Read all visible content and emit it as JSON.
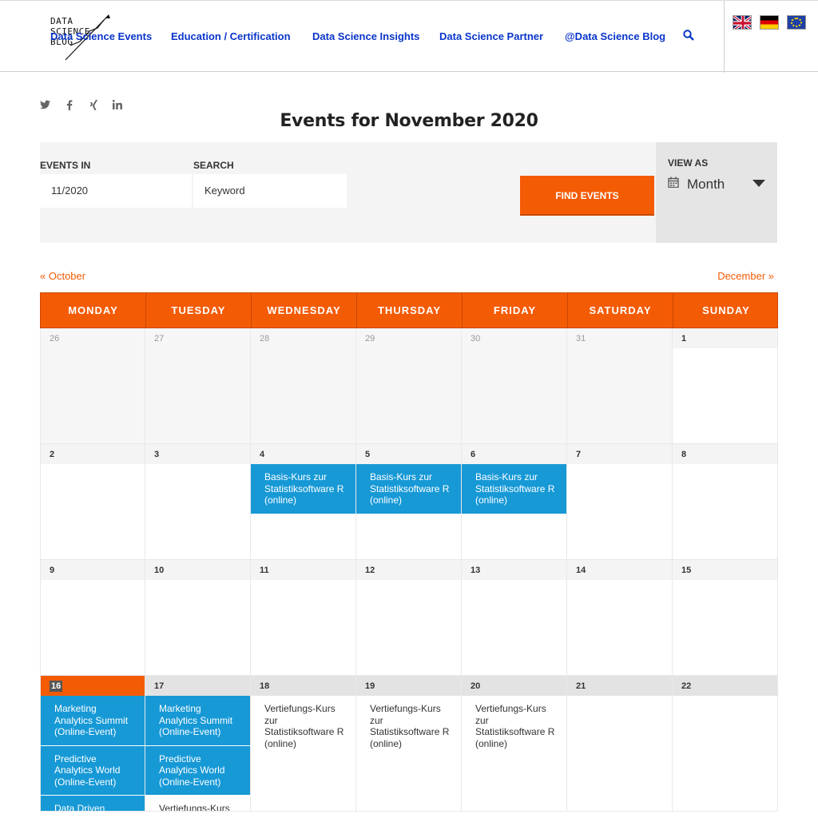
{
  "header": {
    "logo_text": [
      "DATA",
      "SCIENCE",
      "BLOG"
    ],
    "nav": [
      "Data Science Events",
      "Education / Certification",
      "Data Science Insights",
      "Data Science Partner",
      "@Data Science Blog"
    ],
    "flags": [
      "uk-flag",
      "germany-flag",
      "eu-flag"
    ]
  },
  "social": [
    "twitter-icon",
    "facebook-icon",
    "xing-icon",
    "linkedin-icon"
  ],
  "page_title": "Events for November 2020",
  "filter": {
    "events_in_label": "EVENTS IN",
    "events_in_value": "11/2020",
    "search_label": "SEARCH",
    "search_placeholder": "Keyword",
    "find_button": "FIND EVENTS",
    "view_as_label": "VIEW AS",
    "view_as_value": "Month"
  },
  "month_nav": {
    "prev": "« October",
    "next": "December »"
  },
  "colors": {
    "accent": "#f45b05",
    "event_blue": "#1799d6",
    "nav_link": "#0a35c9"
  },
  "calendar": {
    "days": [
      "MONDAY",
      "TUESDAY",
      "WEDNESDAY",
      "THURSDAY",
      "FRIDAY",
      "SATURDAY",
      "SUNDAY"
    ],
    "weeks": [
      [
        {
          "n": "26",
          "past": true
        },
        {
          "n": "27",
          "past": true
        },
        {
          "n": "28",
          "past": true
        },
        {
          "n": "29",
          "past": true
        },
        {
          "n": "30",
          "past": true
        },
        {
          "n": "31",
          "past": true
        },
        {
          "n": "1"
        }
      ],
      [
        {
          "n": "2"
        },
        {
          "n": "3"
        },
        {
          "n": "4",
          "events": [
            {
              "t": "Basis-Kurs zur Statistiksoftware R (online)",
              "blue": true
            }
          ]
        },
        {
          "n": "5",
          "events": [
            {
              "t": "Basis-Kurs zur Statistiksoftware R (online)",
              "blue": true
            }
          ]
        },
        {
          "n": "6",
          "events": [
            {
              "t": "Basis-Kurs zur Statistiksoftware R (online)",
              "blue": true
            }
          ]
        },
        {
          "n": "7"
        },
        {
          "n": "8"
        }
      ],
      [
        {
          "n": "9"
        },
        {
          "n": "10"
        },
        {
          "n": "11"
        },
        {
          "n": "12"
        },
        {
          "n": "13"
        },
        {
          "n": "14"
        },
        {
          "n": "15"
        }
      ],
      [
        {
          "n": "16",
          "today": true,
          "events": [
            {
              "t": "Marketing Analytics Summit (Online-Event)",
              "blue": true
            },
            {
              "t": "Predictive Analytics World (Online-Event)",
              "blue": true
            },
            {
              "t": "Data Driven",
              "blue": true
            }
          ]
        },
        {
          "n": "17",
          "events": [
            {
              "t": "Marketing Analytics Summit (Online-Event)",
              "blue": true
            },
            {
              "t": "Predictive Analytics World (Online-Event)",
              "blue": true
            },
            {
              "t": "Vertiefungs-Kurs",
              "blue": false
            }
          ]
        },
        {
          "n": "18",
          "events": [
            {
              "t": "Vertiefungs-Kurs zur Statistiksoftware R (online)",
              "blue": false
            }
          ]
        },
        {
          "n": "19",
          "events": [
            {
              "t": "Vertiefungs-Kurs zur Statistiksoftware R (online)",
              "blue": false
            }
          ]
        },
        {
          "n": "20",
          "events": [
            {
              "t": "Vertiefungs-Kurs zur Statistiksoftware R (online)",
              "blue": false
            }
          ]
        },
        {
          "n": "21"
        },
        {
          "n": "22"
        }
      ]
    ]
  }
}
